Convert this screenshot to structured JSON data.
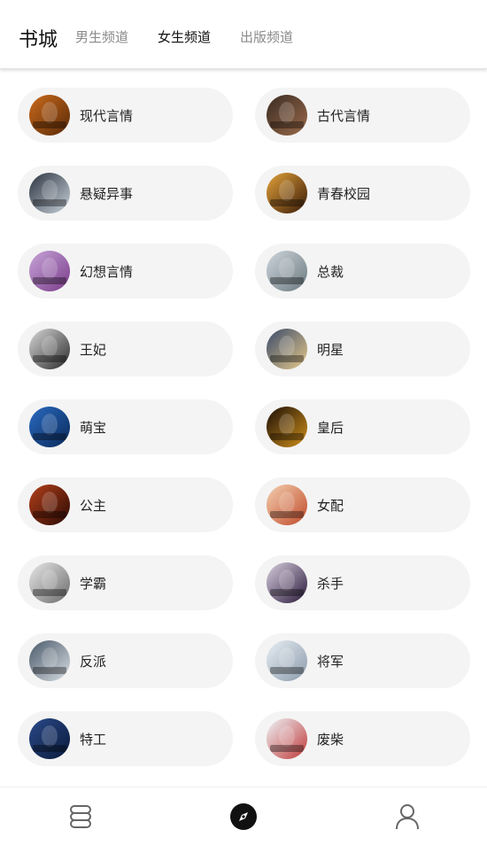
{
  "header": {
    "title": "书城",
    "tabs": [
      {
        "label": "男生频道",
        "active": false
      },
      {
        "label": "女生频道",
        "active": true
      },
      {
        "label": "出版频道",
        "active": false
      }
    ]
  },
  "categories": [
    {
      "label": "现代言情",
      "cover": [
        "#c96a1c",
        "#5a2a08"
      ]
    },
    {
      "label": "古代言情",
      "cover": [
        "#3a2b22",
        "#9a6a4a"
      ]
    },
    {
      "label": "悬疑异事",
      "cover": [
        "#2a3340",
        "#c9d2da"
      ]
    },
    {
      "label": "青春校园",
      "cover": [
        "#e2a23a",
        "#3a1a08"
      ]
    },
    {
      "label": "幻想言情",
      "cover": [
        "#c7a6d8",
        "#7a3a8a"
      ]
    },
    {
      "label": "总裁",
      "cover": [
        "#cfd6dc",
        "#6a7a80"
      ]
    },
    {
      "label": "王妃",
      "cover": [
        "#d8d8d8",
        "#2a2a2a"
      ]
    },
    {
      "label": "明星",
      "cover": [
        "#3a4a6a",
        "#e6c98a"
      ]
    },
    {
      "label": "萌宝",
      "cover": [
        "#2a6ac0",
        "#0a2a5a"
      ]
    },
    {
      "label": "皇后",
      "cover": [
        "#1a0e08",
        "#d0901a"
      ]
    },
    {
      "label": "公主",
      "cover": [
        "#b3401a",
        "#2a0a04"
      ]
    },
    {
      "label": "女配",
      "cover": [
        "#f4d0b0",
        "#c04a2a"
      ]
    },
    {
      "label": "学霸",
      "cover": [
        "#e8e8e8",
        "#6a6a6a"
      ]
    },
    {
      "label": "杀手",
      "cover": [
        "#d8cfe0",
        "#2a1a3a"
      ]
    },
    {
      "label": "反派",
      "cover": [
        "#4a5a6a",
        "#d8dde2"
      ]
    },
    {
      "label": "将军",
      "cover": [
        "#e8eef4",
        "#8a9aaa"
      ]
    },
    {
      "label": "特工",
      "cover": [
        "#2a4a8a",
        "#0a1a3a"
      ]
    },
    {
      "label": "废柴",
      "cover": [
        "#eef4f8",
        "#c03a3a"
      ]
    }
  ],
  "bottom_nav": [
    {
      "icon": "bookshelf-icon",
      "active": false
    },
    {
      "icon": "compass-icon",
      "active": true
    },
    {
      "icon": "profile-icon",
      "active": false
    }
  ]
}
